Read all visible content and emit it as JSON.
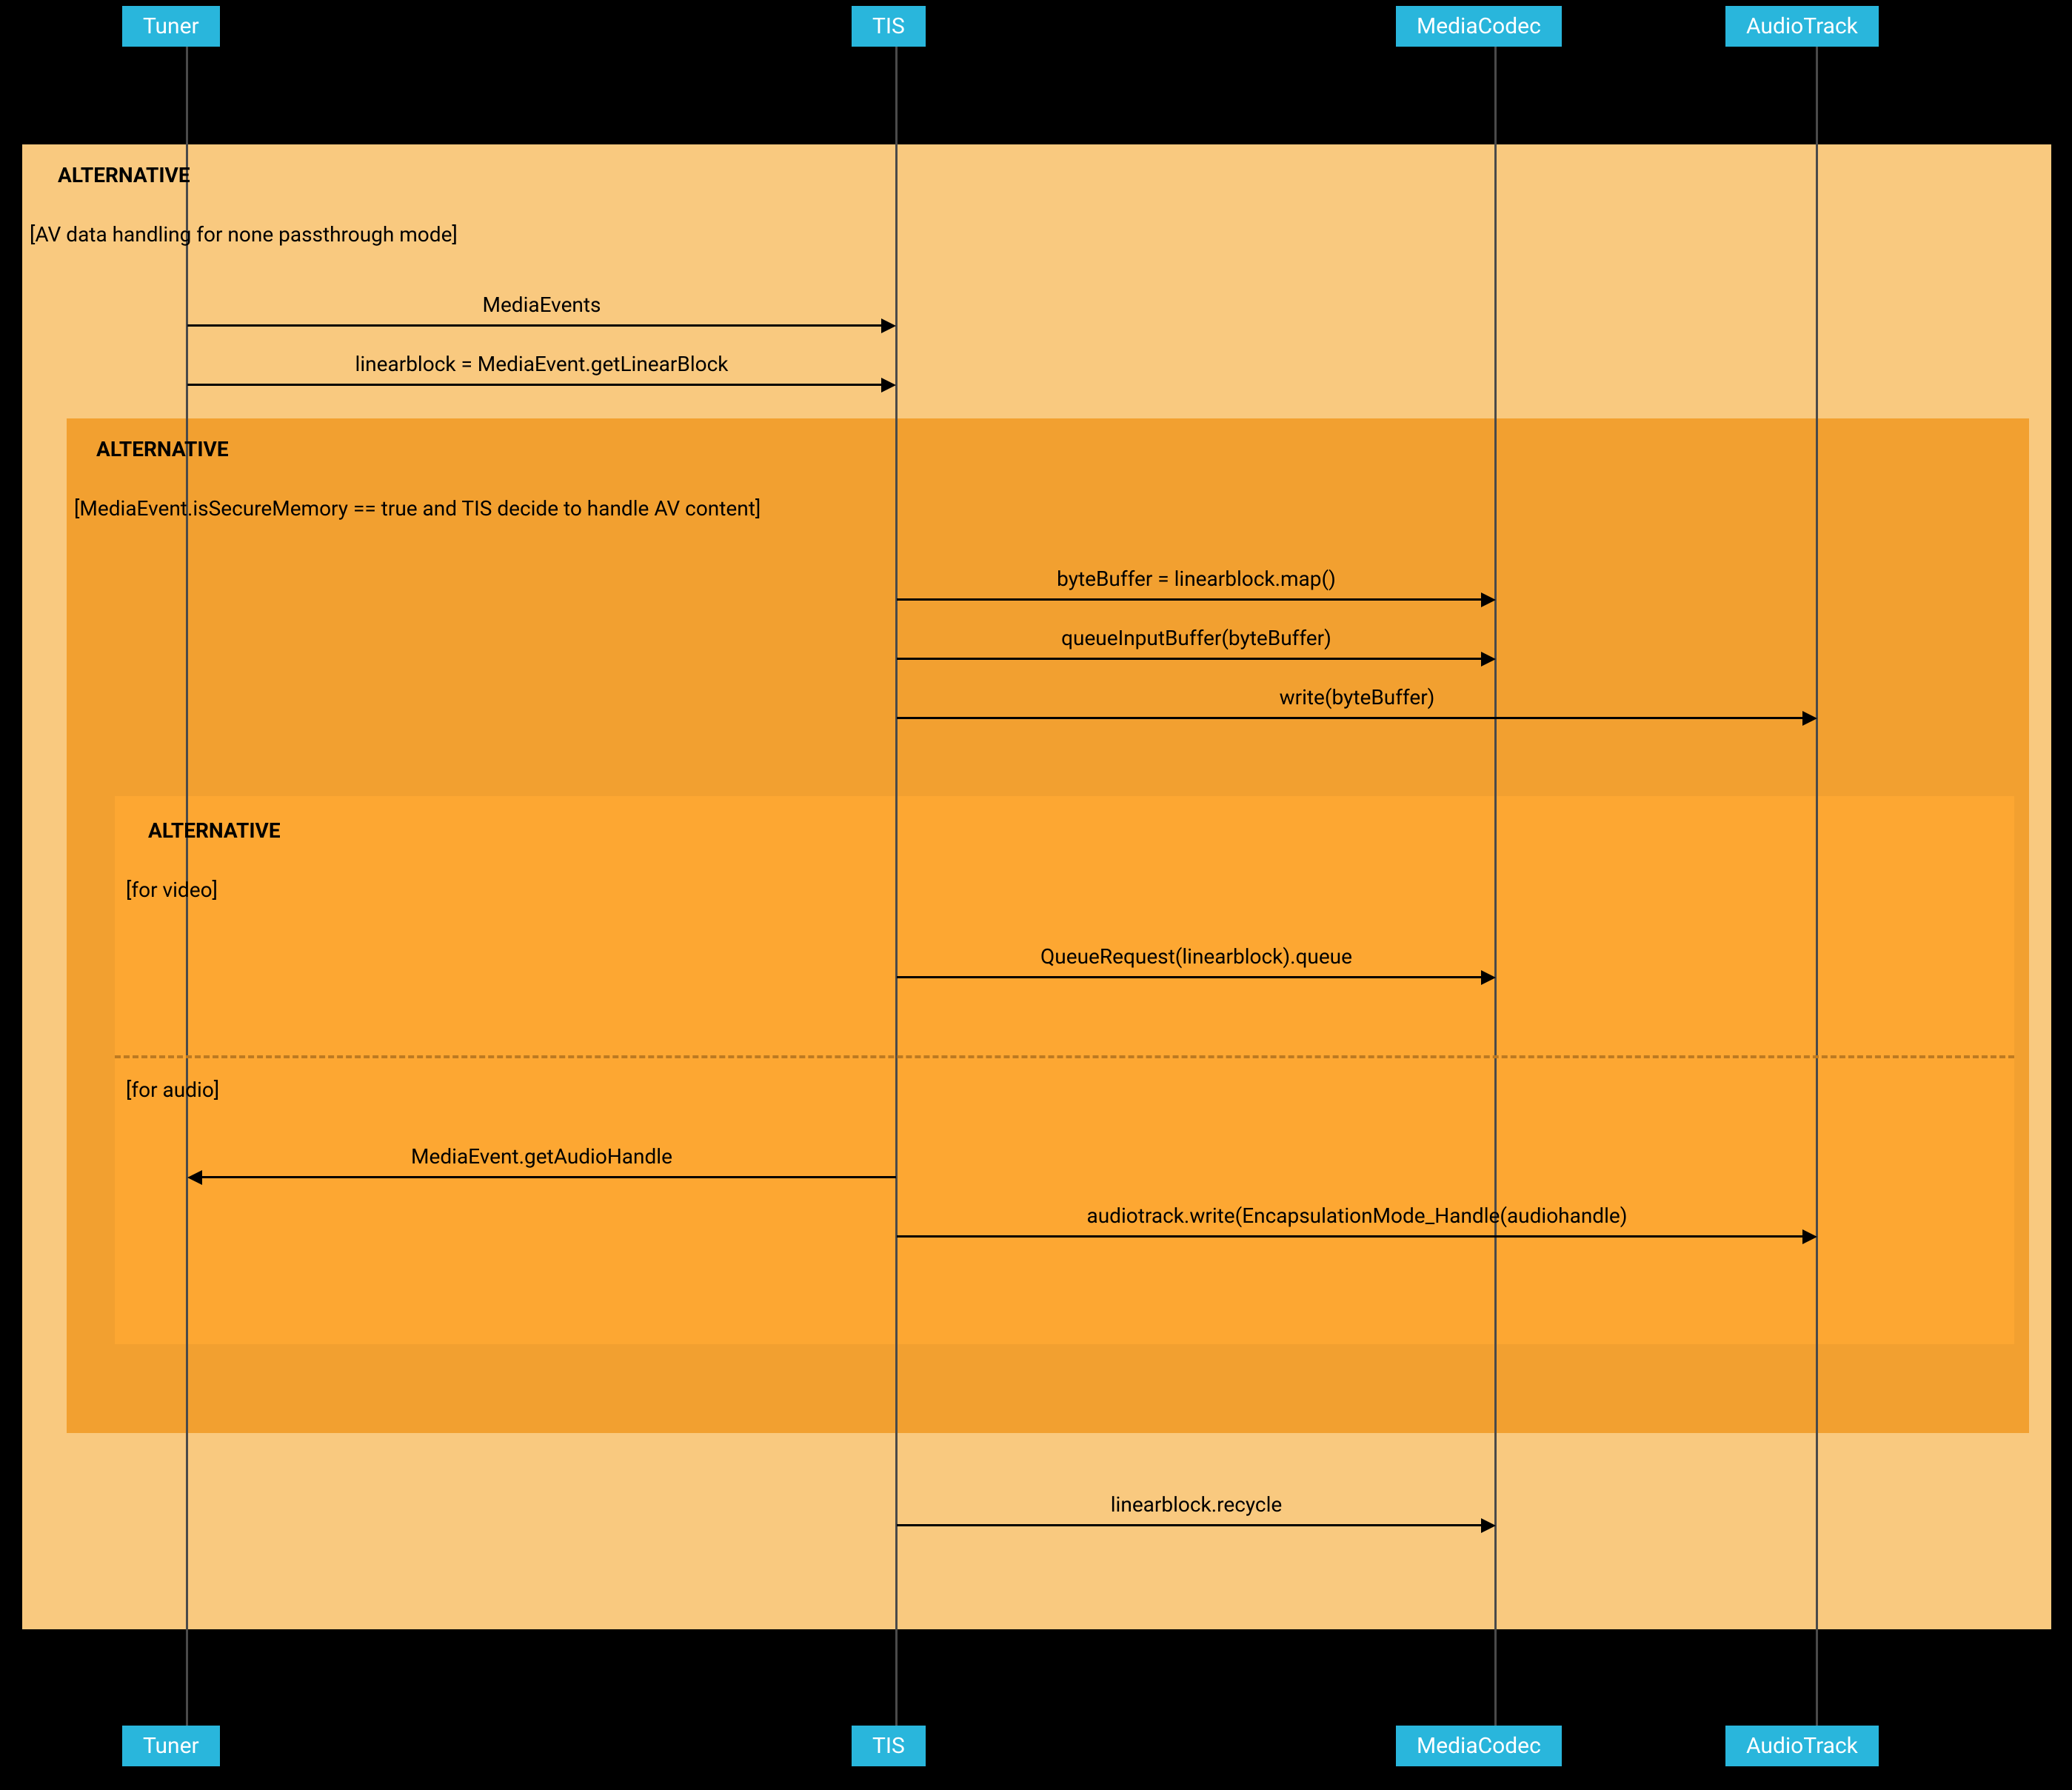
{
  "participants": {
    "tuner": "Tuner",
    "tis": "TIS",
    "mediacodec": "MediaCodec",
    "audiotrack": "AudioTrack"
  },
  "alt1": {
    "label": "ALTERNATIVE",
    "condition": "[AV data handling for none passthrough mode]"
  },
  "alt2": {
    "label": "ALTERNATIVE",
    "condition": "[MediaEvent.isSecureMemory == true and TIS decide to handle AV content]"
  },
  "alt3": {
    "label": "ALTERNATIVE",
    "cond_video": "[for video]",
    "cond_audio": "[for audio]"
  },
  "messages": {
    "m1": "MediaEvents",
    "m2": "linearblock = MediaEvent.getLinearBlock",
    "m3": "byteBuffer = linearblock.map()",
    "m4": "queueInputBuffer(byteBuffer)",
    "m5": "write(byteBuffer)",
    "m6": "QueueRequest(linearblock).queue",
    "m7": "MediaEvent.getAudioHandle",
    "m8": "audiotrack.write(EncapsulationMode_Handle(audiohandle)",
    "m9": "linearblock.recycle"
  },
  "chart_data": {
    "type": "sequence_diagram",
    "participants": [
      "Tuner",
      "TIS",
      "MediaCodec",
      "AudioTrack"
    ],
    "fragments": [
      {
        "type": "alt",
        "label": "ALTERNATIVE",
        "operands": [
          {
            "guard": "AV data handling for none passthrough mode",
            "messages": [
              {
                "from": "Tuner",
                "to": "TIS",
                "text": "MediaEvents"
              },
              {
                "from": "Tuner",
                "to": "TIS",
                "text": "linearblock = MediaEvent.getLinearBlock"
              }
            ],
            "fragments": [
              {
                "type": "alt",
                "label": "ALTERNATIVE",
                "operands": [
                  {
                    "guard": "MediaEvent.isSecureMemory == true and TIS decide to handle AV content",
                    "messages": [
                      {
                        "from": "TIS",
                        "to": "MediaCodec",
                        "text": "byteBuffer = linearblock.map()"
                      },
                      {
                        "from": "TIS",
                        "to": "MediaCodec",
                        "text": "queueInputBuffer(byteBuffer)"
                      },
                      {
                        "from": "TIS",
                        "to": "AudioTrack",
                        "text": "write(byteBuffer)"
                      }
                    ],
                    "fragments": [
                      {
                        "type": "alt",
                        "label": "ALTERNATIVE",
                        "operands": [
                          {
                            "guard": "for video",
                            "messages": [
                              {
                                "from": "TIS",
                                "to": "MediaCodec",
                                "text": "QueueRequest(linearblock).queue"
                              }
                            ]
                          },
                          {
                            "guard": "for audio",
                            "messages": [
                              {
                                "from": "TIS",
                                "to": "Tuner",
                                "text": "MediaEvent.getAudioHandle"
                              },
                              {
                                "from": "TIS",
                                "to": "AudioTrack",
                                "text": "audiotrack.write(EncapsulationMode_Handle(audiohandle)"
                              }
                            ]
                          }
                        ]
                      }
                    ]
                  }
                ]
              }
            ],
            "messages_after": [
              {
                "from": "TIS",
                "to": "MediaCodec",
                "text": "linearblock.recycle"
              }
            ]
          }
        ]
      }
    ]
  }
}
